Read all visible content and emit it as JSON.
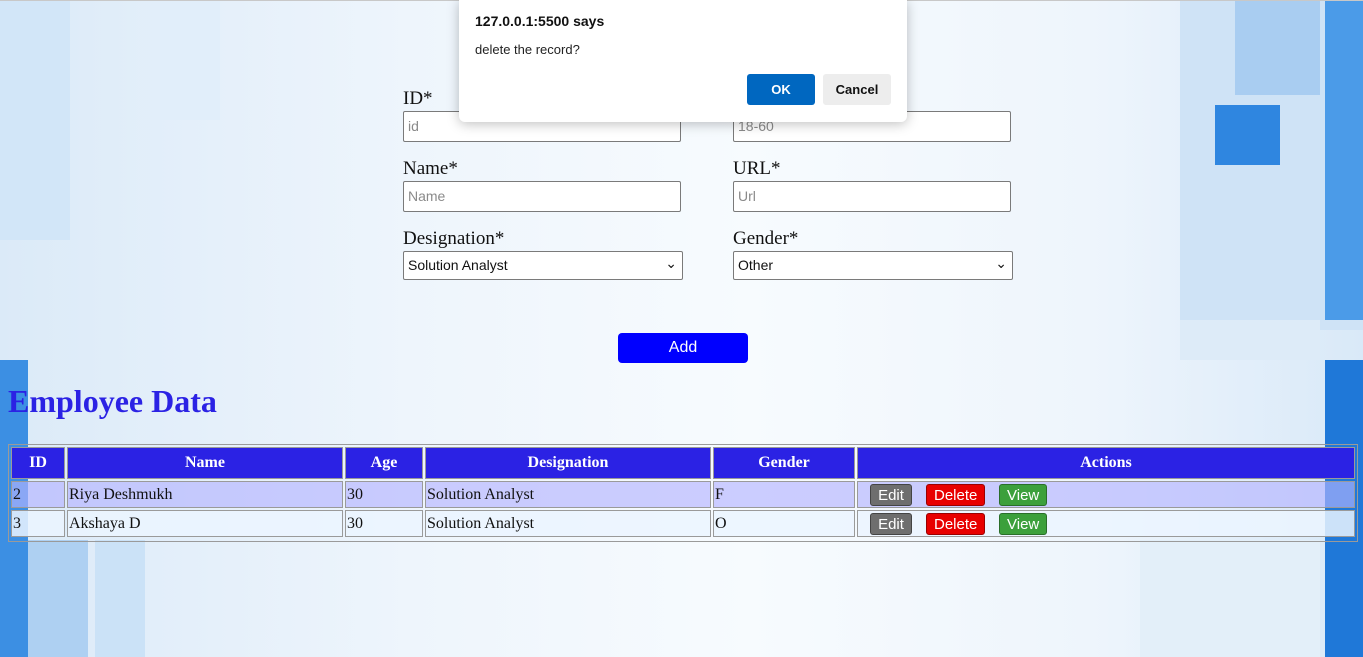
{
  "dialog": {
    "title": "127.0.0.1:5500 says",
    "message": "delete the record?",
    "ok_label": "OK",
    "cancel_label": "Cancel"
  },
  "form": {
    "id_label": "ID*",
    "id_placeholder": "id",
    "age_placeholder": "18-60",
    "name_label": "Name*",
    "name_placeholder": "Name",
    "url_label": "URL*",
    "url_placeholder": "Url",
    "designation_label": "Designation*",
    "designation_value": "Solution Analyst",
    "gender_label": "Gender*",
    "gender_value": "Other",
    "add_label": "Add"
  },
  "section_title": "Employee Data",
  "table": {
    "headers": [
      "ID",
      "Name",
      "Age",
      "Designation",
      "Gender",
      "Actions"
    ],
    "rows": [
      {
        "id": "2",
        "name": "Riya Deshmukh",
        "age": "30",
        "designation": "Solution Analyst",
        "gender": "F"
      },
      {
        "id": "3",
        "name": "Akshaya D",
        "age": "30",
        "designation": "Solution Analyst",
        "gender": "O"
      }
    ],
    "edit_label": "Edit",
    "delete_label": "Delete",
    "view_label": "View"
  },
  "colors": {
    "header_bg": "#2b22e4",
    "add_button": "#0000ff",
    "delete_button": "#e80000",
    "view_button": "#3ca03c",
    "edit_button": "#6e6e6e",
    "dialog_ok": "#0067c0"
  }
}
